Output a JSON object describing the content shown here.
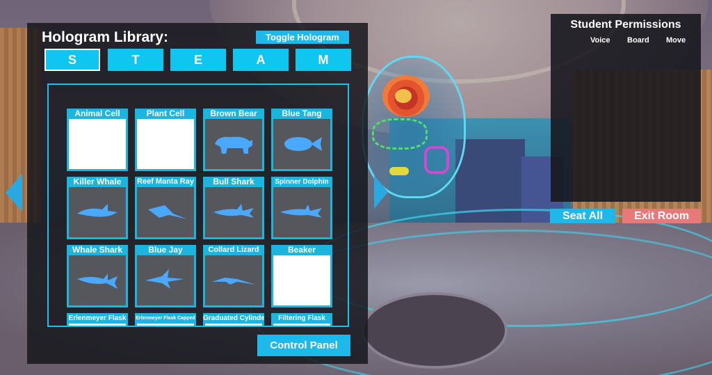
{
  "library": {
    "title": "Hologram Library:",
    "toggle_label": "Toggle Hologram",
    "tabs": [
      {
        "label": "S",
        "active": true
      },
      {
        "label": "T",
        "active": false
      },
      {
        "label": "E",
        "active": false
      },
      {
        "label": "A",
        "active": false
      },
      {
        "label": "M",
        "active": false
      }
    ],
    "items": [
      {
        "label": "Animal Cell",
        "icon": "blank"
      },
      {
        "label": "Plant Cell",
        "icon": "blank"
      },
      {
        "label": "Brown Bear",
        "icon": "bear"
      },
      {
        "label": "Blue Tang",
        "icon": "fish"
      },
      {
        "label": "Killer Whale",
        "icon": "whale"
      },
      {
        "label": "Reef Manta Ray",
        "icon": "manta"
      },
      {
        "label": "Bull Shark",
        "icon": "shark"
      },
      {
        "label": "Spinner Dolphin",
        "icon": "dolphin"
      },
      {
        "label": "Whale Shark",
        "icon": "whaleshark"
      },
      {
        "label": "Blue Jay",
        "icon": "bird"
      },
      {
        "label": "Collard Lizard",
        "icon": "lizard"
      },
      {
        "label": "Beaker",
        "icon": "blank"
      },
      {
        "label": "Erlenmeyer Flask",
        "icon": "blank"
      },
      {
        "label": "Erlenmeyer Flask Capped",
        "icon": "blank"
      },
      {
        "label": "Graduated Cylinder",
        "icon": "blank"
      },
      {
        "label": "Filtering Flask",
        "icon": "blank"
      }
    ],
    "control_panel_label": "Control Panel"
  },
  "permissions": {
    "title": "Student Permissions",
    "columns": [
      "Voice",
      "Board",
      "Move"
    ]
  },
  "room": {
    "seat_all_label": "Seat All",
    "exit_room_label": "Exit Room"
  },
  "colors": {
    "accent": "#1fb8ea",
    "tab": "#0fc6f0",
    "danger": "#e8797a",
    "hologram": "#4aa8ff"
  }
}
